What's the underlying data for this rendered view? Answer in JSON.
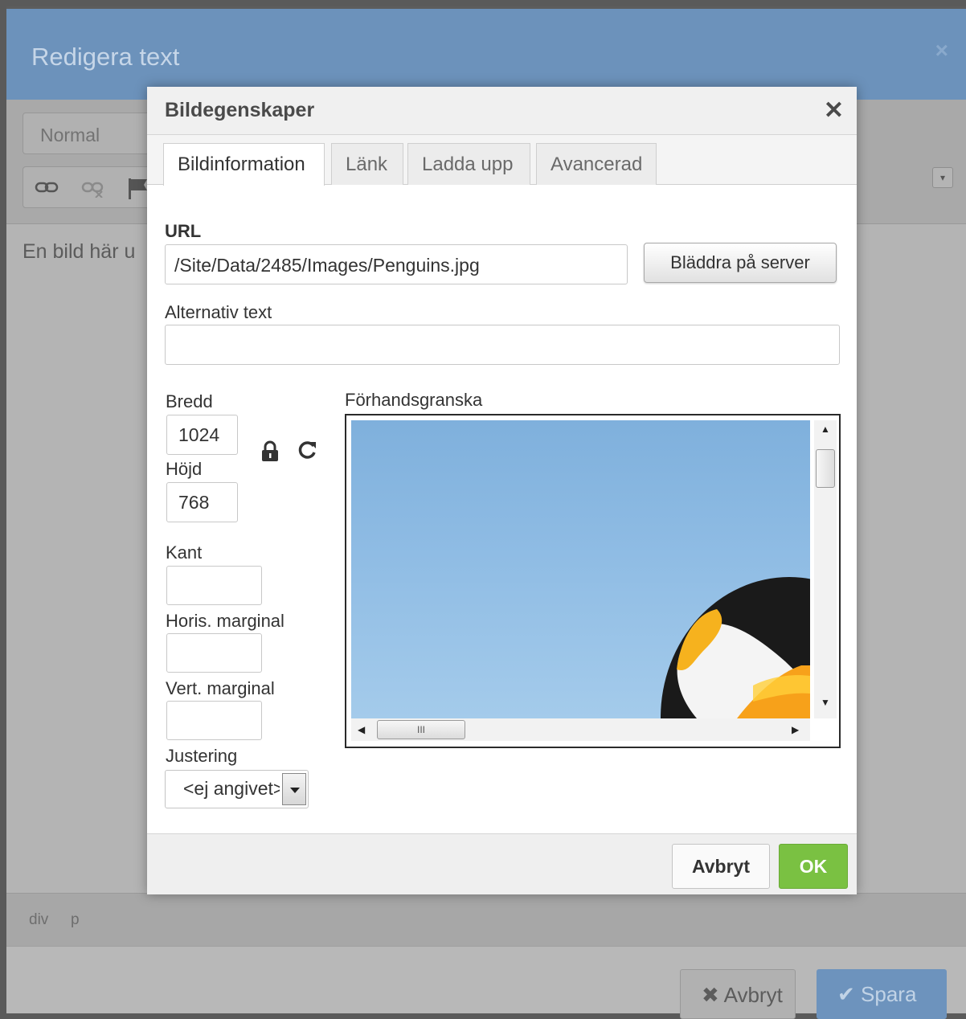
{
  "outer": {
    "title": "Redigera text",
    "close_glyph": "×",
    "format_value": "Normal",
    "content_text": "En bild här u",
    "path": [
      "div",
      "p"
    ],
    "cancel_label": "Avbryt",
    "save_label": "Spara",
    "cancel_icon": "✖",
    "save_icon": "✔"
  },
  "dialog": {
    "title": "Bildegenskaper",
    "close_glyph": "✕",
    "tabs": [
      {
        "label": "Bildinformation",
        "active": true
      },
      {
        "label": "Länk",
        "active": false
      },
      {
        "label": "Ladda upp",
        "active": false
      },
      {
        "label": "Avancerad",
        "active": false
      }
    ],
    "url_label": "URL",
    "url_value": "/Site/Data/2485/Images/Penguins.jpg",
    "browse_label": "Bläddra på server",
    "alt_label": "Alternativ text",
    "alt_value": "",
    "width_label": "Bredd",
    "width_value": "1024",
    "height_label": "Höjd",
    "height_value": "768",
    "border_label": "Kant",
    "border_value": "",
    "hspace_label": "Horis. marginal",
    "hspace_value": "",
    "vspace_label": "Vert. marginal",
    "vspace_value": "",
    "align_label": "Justering",
    "align_value": "<ej angivet>",
    "preview_label": "Förhandsgranska",
    "scroll_grip": "III",
    "cancel_label": "Avbryt",
    "ok_label": "OK"
  },
  "colors": {
    "header_blue": "#6c92bb",
    "ok_green": "#7ac142",
    "sky": "#8fbce4"
  },
  "icons": [
    "link-icon",
    "unlink-icon",
    "flag-icon",
    "lock-icon",
    "reset-icon",
    "close-icon"
  ]
}
